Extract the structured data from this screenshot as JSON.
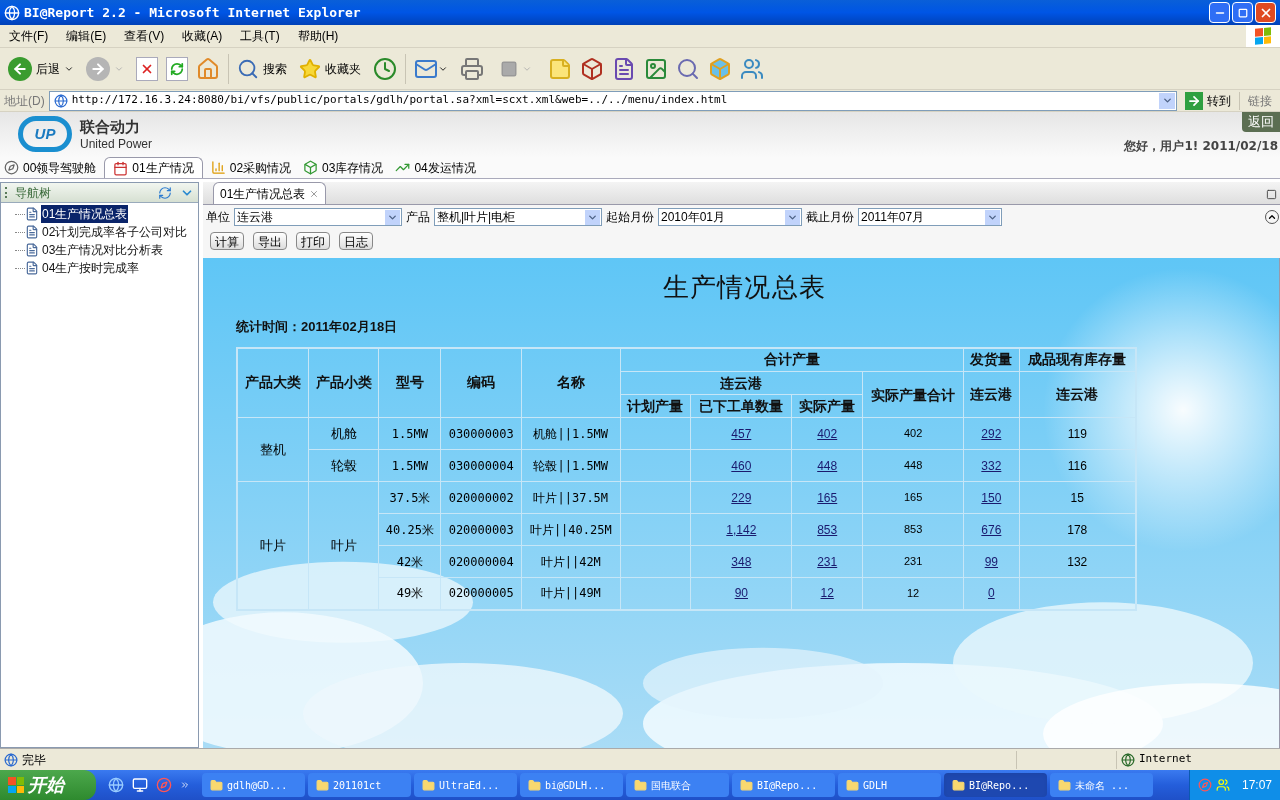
{
  "window": {
    "title": "BI@Report 2.2 - Microsoft Internet Explorer"
  },
  "menu": [
    "文件(F)",
    "编辑(E)",
    "查看(V)",
    "收藏(A)",
    "工具(T)",
    "帮助(H)"
  ],
  "toolbar": {
    "back": "后退",
    "search": "搜索",
    "favorites": "收藏夹"
  },
  "address": {
    "label": "地址(D)",
    "url": "http://172.16.3.24:8080/bi/vfs/public/portals/gdlh/portal.sa?xml=scxt.xml&web=../../menu/index.html",
    "go": "转到",
    "links": "链接"
  },
  "header": {
    "logo_mark": "UP",
    "logo_cn": "联合动力",
    "logo_en": "United Power",
    "back": "返回",
    "greeting": "您好，用户1! 2011/02/18"
  },
  "portal_tabs": [
    {
      "label": "00领导驾驶舱",
      "selected": false
    },
    {
      "label": "01生产情况",
      "selected": true
    },
    {
      "label": "02采购情况",
      "selected": false
    },
    {
      "label": "03库存情况",
      "selected": false
    },
    {
      "label": "04发运情况",
      "selected": false
    }
  ],
  "sidebar": {
    "title": "导航树",
    "items": [
      {
        "label": "01生产情况总表",
        "selected": true
      },
      {
        "label": "02计划完成率各子公司对比",
        "selected": false
      },
      {
        "label": "03生产情况对比分析表",
        "selected": false
      },
      {
        "label": "04生产按时完成率",
        "selected": false
      }
    ]
  },
  "doc_tab": {
    "label": "01生产情况总表"
  },
  "filters": [
    {
      "label": "单位",
      "value": "连云港"
    },
    {
      "label": "产品",
      "value": "整机|叶片|电柜"
    },
    {
      "label": "起始月份",
      "value": "2010年01月"
    },
    {
      "label": "截止月份",
      "value": "2011年07月"
    }
  ],
  "actions": [
    "计算",
    "导出",
    "打印",
    "日志"
  ],
  "report": {
    "title": "生产情况总表",
    "stat_time": "统计时间：2011年02月18日",
    "header_rows": [
      [
        "产品大类",
        "产品小类",
        "型号",
        "编码",
        "名称",
        "合计产量",
        "发货量",
        "成品现有库存量"
      ],
      [
        "连云港",
        "实际产量合计",
        "连云港",
        "连云港"
      ],
      [
        "计划产量",
        "已下工单数量",
        "实际产量"
      ]
    ],
    "categories": [
      {
        "name": "整机",
        "subcategories": [
          {
            "name": "机舱",
            "rows": [
              {
                "model": "1.5MW",
                "code": "030000003",
                "name": "机舱||1.5MW",
                "orders": "457",
                "actual": "402",
                "total": "402",
                "shipped": "292",
                "stock": "119"
              }
            ]
          },
          {
            "name": "轮毂",
            "rows": [
              {
                "model": "1.5MW",
                "code": "030000004",
                "name": "轮毂||1.5MW",
                "orders": "460",
                "actual": "448",
                "total": "448",
                "shipped": "332",
                "stock": "116"
              }
            ]
          }
        ]
      },
      {
        "name": "叶片",
        "subcategories": [
          {
            "name": "叶片",
            "rows": [
              {
                "model": "37.5米",
                "code": "020000002",
                "name": "叶片||37.5M",
                "orders": "229",
                "actual": "165",
                "total": "165",
                "shipped": "150",
                "stock": "15"
              },
              {
                "model": "40.25米",
                "code": "020000003",
                "name": "叶片||40.25M",
                "orders": "1,142",
                "actual": "853",
                "total": "853",
                "shipped": "676",
                "stock": "178"
              },
              {
                "model": "42米",
                "code": "020000004",
                "name": "叶片||42M",
                "orders": "348",
                "actual": "231",
                "total": "231",
                "shipped": "99",
                "stock": "132"
              },
              {
                "model": "49米",
                "code": "020000005",
                "name": "叶片||49M",
                "orders": "90",
                "actual": "12",
                "total": "12",
                "shipped": "0"
              }
            ]
          }
        ]
      }
    ]
  },
  "status_bar": {
    "text": "完毕",
    "zone": "Internet"
  },
  "taskbar": {
    "start": "开始",
    "items": [
      {
        "label": "gdlh@GD...",
        "selected": false
      },
      {
        "label": "201101ct",
        "selected": false
      },
      {
        "label": "UltraEd...",
        "selected": false
      },
      {
        "label": "bi@GDLH...",
        "selected": false
      },
      {
        "label": "国电联合",
        "selected": false
      },
      {
        "label": "BI@Repo...",
        "selected": false
      },
      {
        "label": "GDLH",
        "selected": false
      },
      {
        "label": "BI@Repo...",
        "selected": true
      },
      {
        "label": "未命名 ...",
        "selected": false
      }
    ],
    "clock": "17:07"
  }
}
